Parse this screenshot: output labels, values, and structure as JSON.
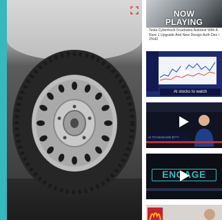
{
  "main_media": {
    "accent_color": "#35b9be",
    "expand_icon_color": "#e0403a",
    "expand_icon": "expand-icon"
  },
  "sidebar": {
    "thumbs": [
      {
        "overlay_line1": "NOW",
        "overlay_line2": "PLAYING",
        "caption": "Tesla Cybertruck Frustrates Autotest With A Rare 1 Upgrade And New Design Auth Dev / 2%42",
        "play_icon": "none"
      },
      {
        "caption": "AI stocks to watch",
        "play_icon": "play-icon"
      },
      {
        "banner": "AI TO MANAGE $???",
        "play_icon": "play-icon"
      },
      {
        "word": "ENGAGE",
        "play_icon": "play-icon"
      },
      {
        "logo": "M",
        "play_icon": "none"
      }
    ]
  }
}
